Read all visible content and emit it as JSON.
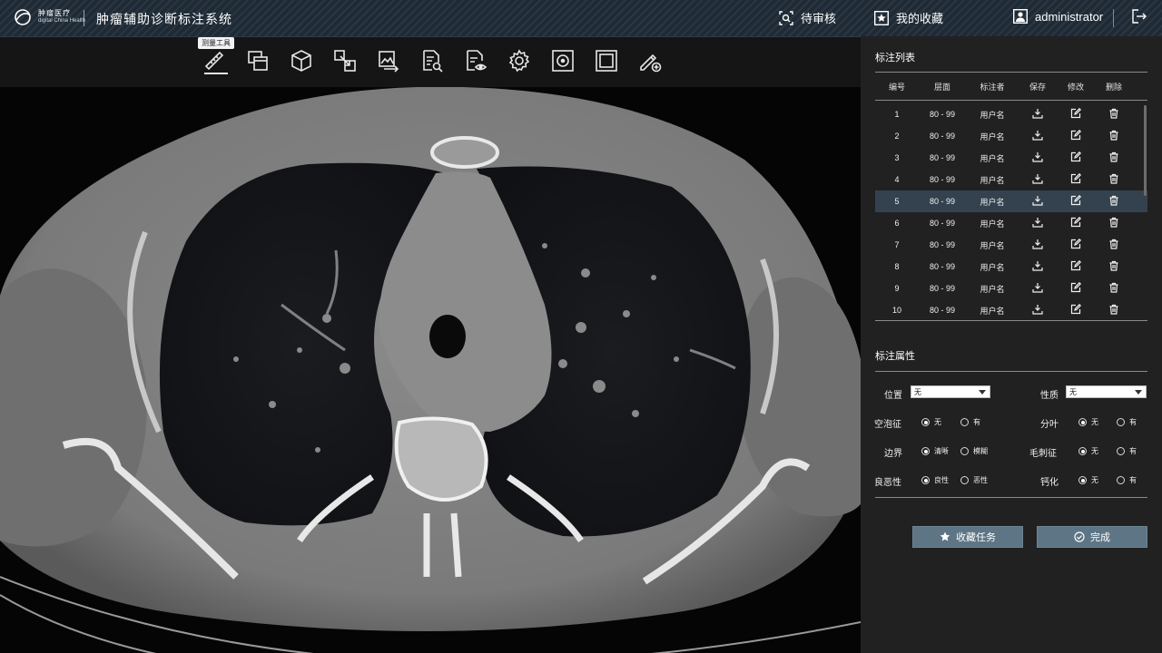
{
  "header": {
    "logo_cn": "肿瘤医疗",
    "logo_en": "digital China Health",
    "title": "肿瘤辅助诊断标注系统",
    "pending_review": "待审核",
    "my_favorites": "我的收藏",
    "username": "administrator"
  },
  "toolbar": {
    "tooltip": "测量工具",
    "tools": [
      "ruler",
      "window-level",
      "3d-cube",
      "zoom",
      "image-export",
      "report",
      "document-view",
      "settings",
      "target",
      "frame",
      "pen-add"
    ]
  },
  "annotation_list": {
    "title": "标注列表",
    "columns": [
      "编号",
      "层面",
      "标注者",
      "保存",
      "修改",
      "删除"
    ],
    "rows": [
      {
        "no": "1",
        "layer": "80 - 99",
        "user": "用户名"
      },
      {
        "no": "2",
        "layer": "80 - 99",
        "user": "用户名"
      },
      {
        "no": "3",
        "layer": "80 - 99",
        "user": "用户名"
      },
      {
        "no": "4",
        "layer": "80 - 99",
        "user": "用户名"
      },
      {
        "no": "5",
        "layer": "80 - 99",
        "user": "用户名"
      },
      {
        "no": "6",
        "layer": "80 - 99",
        "user": "用户名"
      },
      {
        "no": "7",
        "layer": "80 - 99",
        "user": "用户名"
      },
      {
        "no": "8",
        "layer": "80 - 99",
        "user": "用户名"
      },
      {
        "no": "9",
        "layer": "80 - 99",
        "user": "用户名"
      },
      {
        "no": "10",
        "layer": "80 - 99",
        "user": "用户名"
      }
    ],
    "selected_row": "5"
  },
  "attributes": {
    "title": "标注属性",
    "position_label": "位置",
    "position_value": "无",
    "nature_label": "性质",
    "nature_value": "无",
    "vacuole_label": "空泡征",
    "vacuole_opt1": "无",
    "vacuole_opt2": "有",
    "lobulation_label": "分叶",
    "lobulation_opt1": "无",
    "lobulation_opt2": "有",
    "border_label": "边界",
    "border_opt1": "清晰",
    "border_opt2": "模糊",
    "spiculation_label": "毛刺征",
    "spiculation_opt1": "无",
    "spiculation_opt2": "有",
    "malignancy_label": "良恶性",
    "malignancy_opt1": "良性",
    "malignancy_opt2": "恶性",
    "calcification_label": "钙化",
    "calcification_opt1": "无",
    "calcification_opt2": "有"
  },
  "buttons": {
    "favorite_task": "收藏任务",
    "complete": "完成"
  }
}
